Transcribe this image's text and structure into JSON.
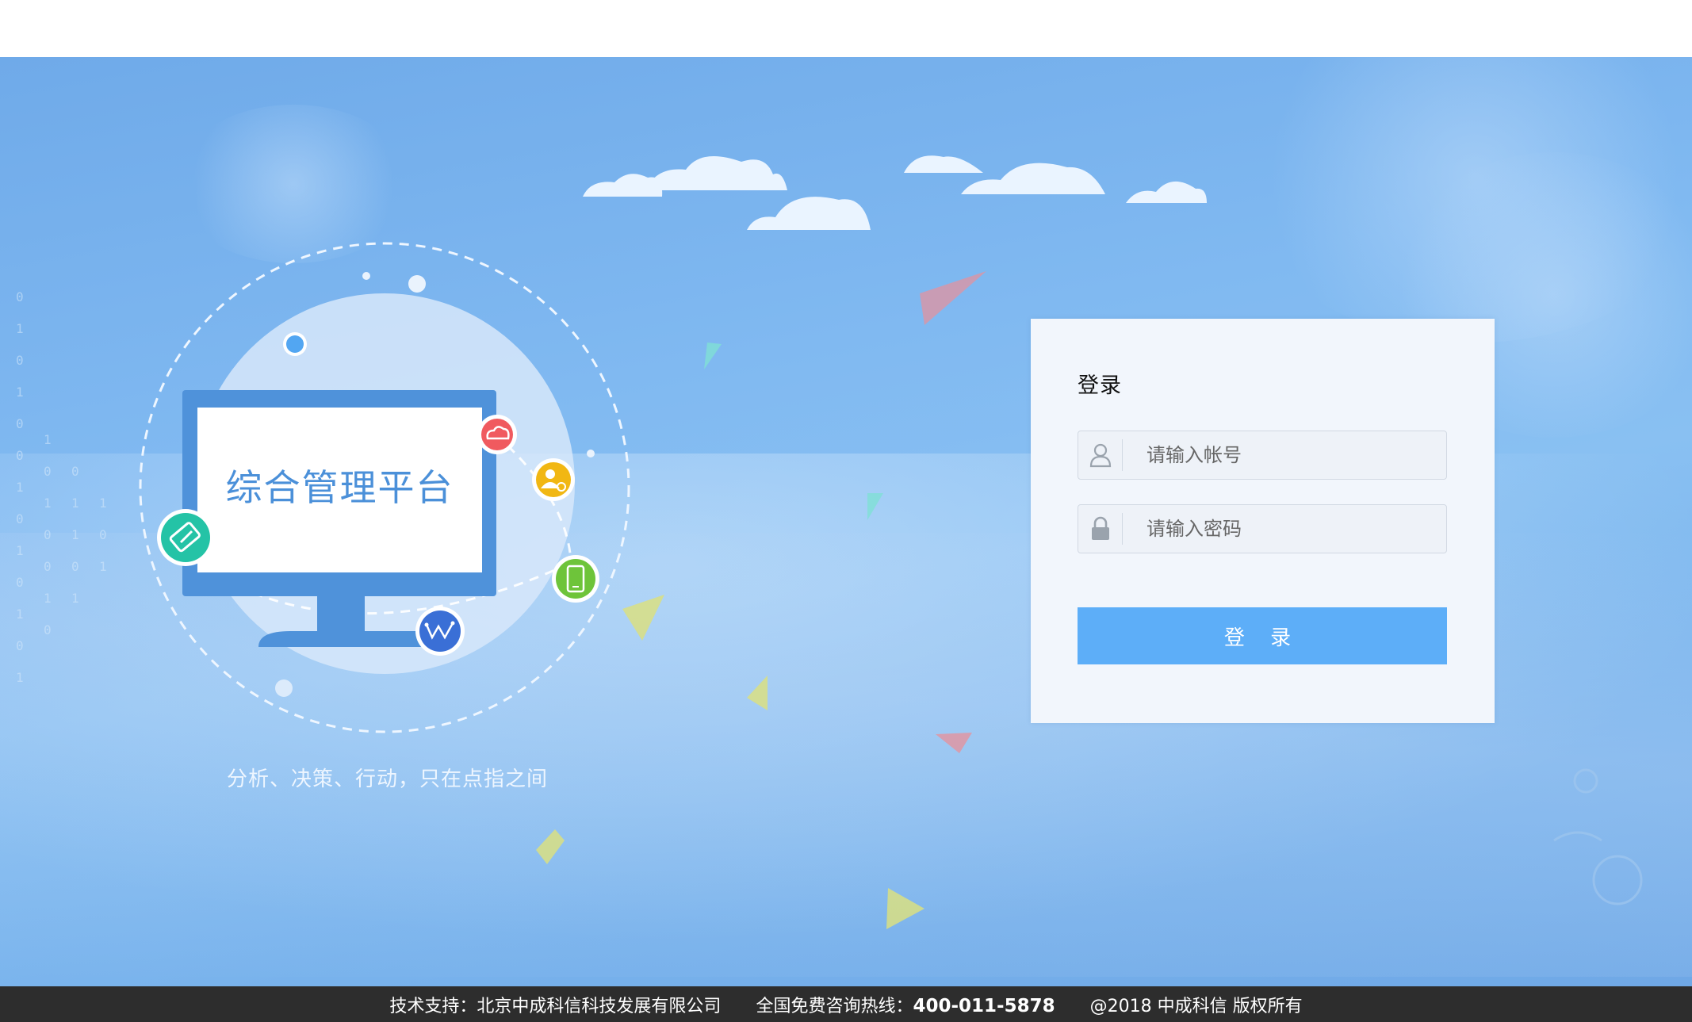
{
  "hero": {
    "monitor_title": "综合管理平台",
    "tagline": "分析、决策、行动，只在点指之间",
    "icons": [
      "ticket-icon",
      "cloud-icon",
      "user-settings-icon",
      "mobile-icon",
      "chart-line-icon"
    ]
  },
  "login": {
    "title": "登录",
    "account_placeholder": "请输入帐号",
    "password_placeholder": "请输入密码",
    "button_label": "登 录"
  },
  "footer": {
    "support": "技术支持：北京中成科信科技发展有限公司",
    "hotline_label": "全国免费咨询热线：",
    "hotline_number": "400-011-5878",
    "copyright": "@2018 中成科信 版权所有"
  },
  "colors": {
    "primary_button": "#5daef8",
    "footer_bg": "#2d2d2d",
    "monitor_blue": "#4b90d9"
  }
}
